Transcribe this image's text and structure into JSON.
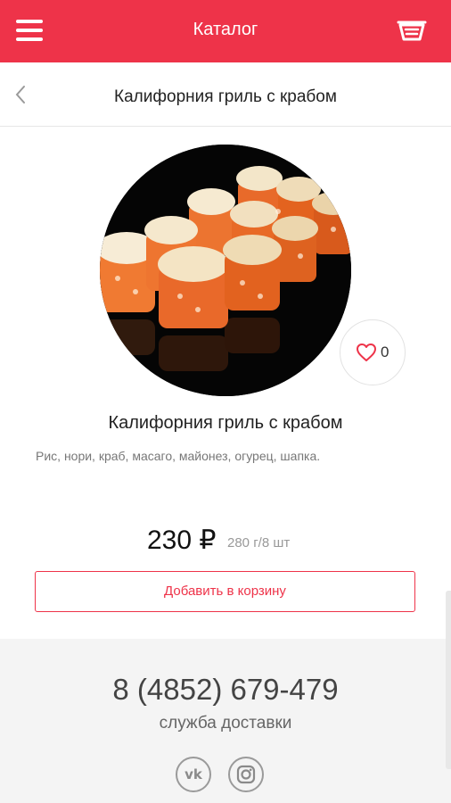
{
  "appbar": {
    "title": "Каталог",
    "menu_icon": "hamburger-menu-icon",
    "cart_icon": "basket-icon",
    "color": "#ee3349"
  },
  "subheader": {
    "back_icon": "chevron-left-icon",
    "title": "Калифорния гриль с крабом"
  },
  "product": {
    "image": "sushi-rolls-photo",
    "name": "Калифорния гриль с крабом",
    "description": "Рис, нори, краб, масаго, майонез, огурец, шапка.",
    "price": "230 ₽",
    "weight": "280 г/8 шт",
    "likes": "0",
    "like_icon": "heart-icon",
    "add_to_cart_label": "Добавить в корзину"
  },
  "footer": {
    "phone": "8 (4852) 679-479",
    "caption": "служба доставки",
    "socials": [
      "vk-icon",
      "instagram-icon"
    ]
  }
}
